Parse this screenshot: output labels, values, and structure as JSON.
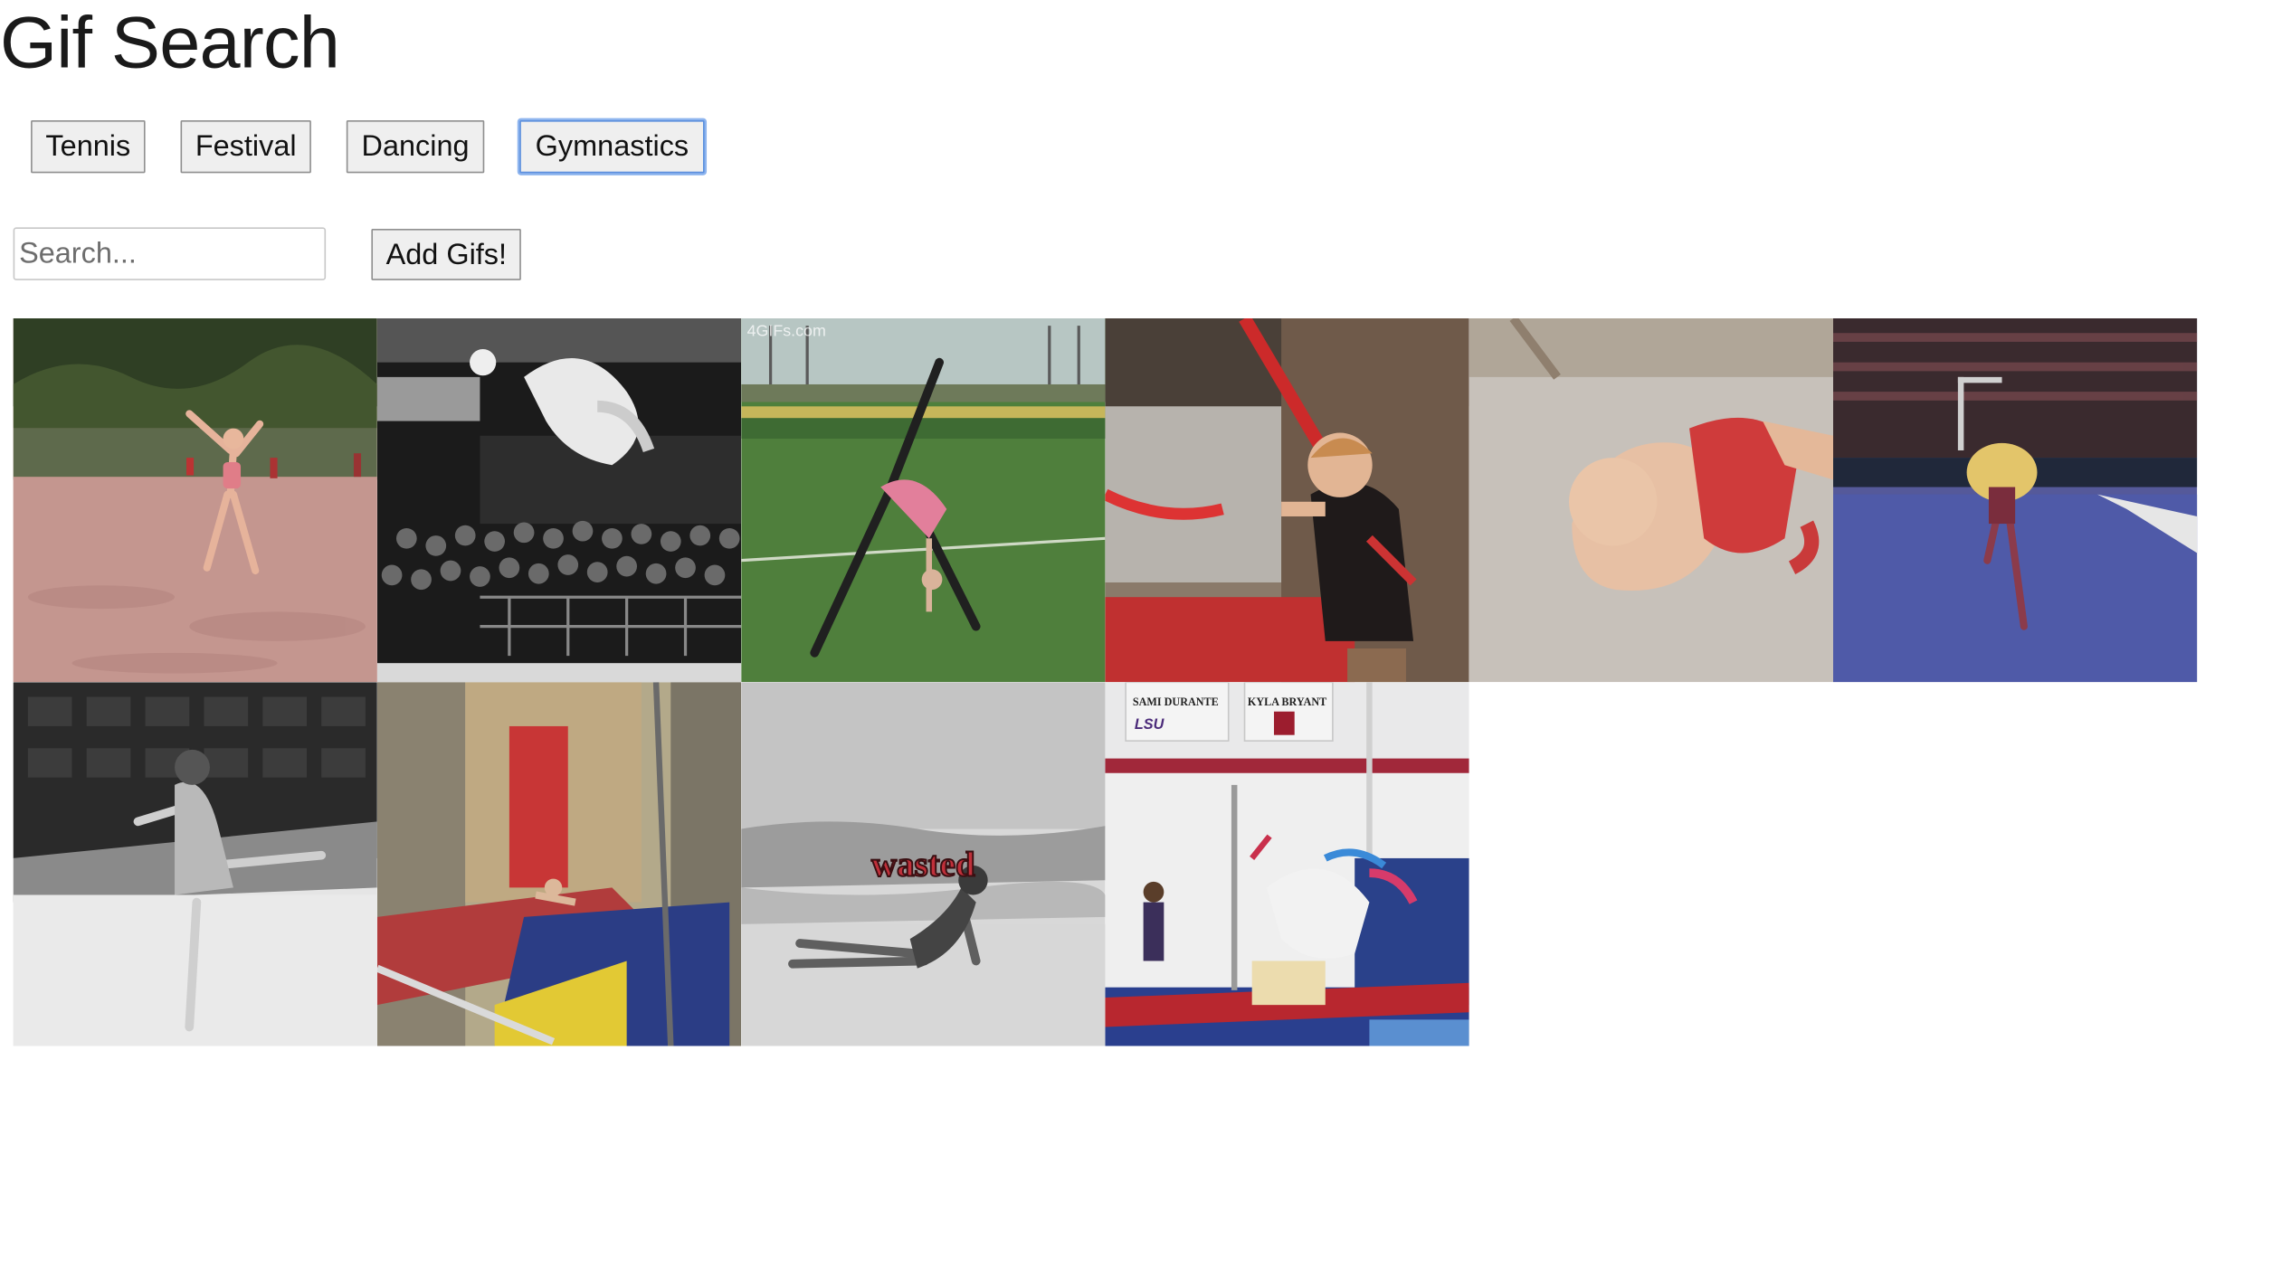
{
  "page": {
    "title": "Gif Search"
  },
  "topics": {
    "buttons": [
      {
        "label": "Tennis"
      },
      {
        "label": "Festival"
      },
      {
        "label": "Dancing"
      },
      {
        "label": "Gymnastics",
        "focused": true
      }
    ]
  },
  "search": {
    "placeholder": "Search...",
    "value": "",
    "add_label": "Add Gifs!"
  },
  "gifs": [
    {
      "name": "gif-beach-gymnast",
      "watermark": ""
    },
    {
      "name": "gif-bw-flip-arena",
      "watermark": ""
    },
    {
      "name": "gif-field-walkover",
      "watermark": "4GIFs.com"
    },
    {
      "name": "gif-kid-gym-bar",
      "watermark": ""
    },
    {
      "name": "gif-kid-on-carpet",
      "watermark": ""
    },
    {
      "name": "gif-floor-routine-arena",
      "watermark": ""
    },
    {
      "name": "gif-bw-rhythmic-gymnast",
      "watermark": ""
    },
    {
      "name": "gif-vault-fall-gym",
      "watermark": ""
    },
    {
      "name": "gif-wasted-beach",
      "caption": "wasted"
    },
    {
      "name": "gif-unicorn-bars",
      "banners": [
        "SAMI DURANTE",
        "KYLA BRYANT"
      ],
      "banner_logo": "LSU"
    }
  ],
  "colors": {
    "button_bg": "#efefef",
    "button_border": "#8f8f8f",
    "focus_ring": "#5b8fdd"
  }
}
